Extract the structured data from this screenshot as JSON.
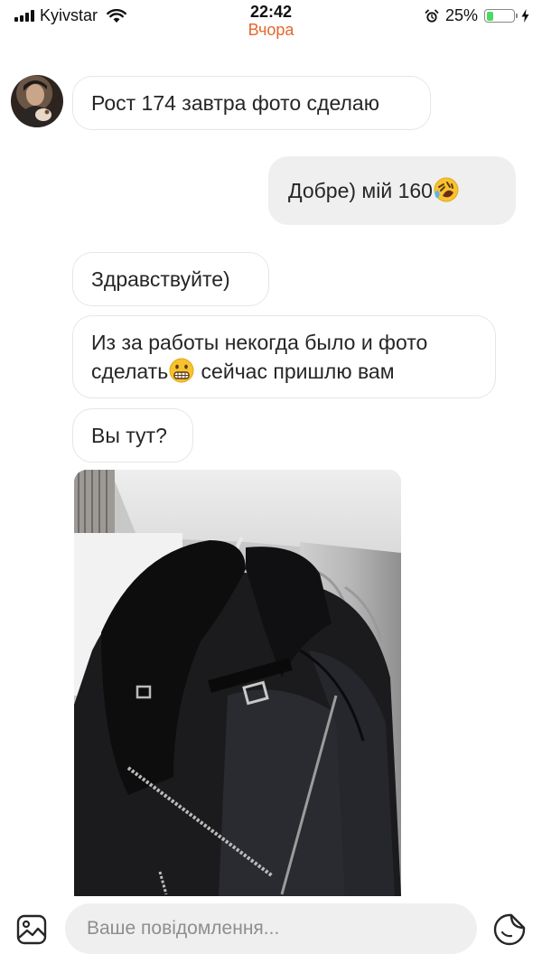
{
  "status_bar": {
    "carrier": "Kyivstar",
    "time": "22:42",
    "day_label": "Вчора",
    "battery_percent": "25%",
    "battery_level": 0.25,
    "icons": [
      "signal-icon",
      "wifi-icon",
      "alarm-icon",
      "battery-icon",
      "charging-bolt-icon"
    ]
  },
  "messages": [
    {
      "direction": "incoming",
      "text": "Рост 174 завтра фото сделаю"
    },
    {
      "direction": "outgoing",
      "text": "Добре) мій 160",
      "emoji": "rolling-laughing-emoji"
    },
    {
      "direction": "incoming",
      "text": "Здравствуйте)"
    },
    {
      "direction": "incoming",
      "line1": "Из за работы некогда было и фото",
      "line2_a": "сделать",
      "emoji": "grimacing-emoji",
      "line2_b": " сейчас пришлю вам"
    },
    {
      "direction": "incoming",
      "text": "Вы тут?"
    },
    {
      "direction": "incoming",
      "type": "photo",
      "subject": "black-leather-jacket-photo"
    }
  ],
  "composer": {
    "placeholder": "Ваше повідомлення...",
    "value": "",
    "icons": [
      "gallery-icon",
      "sticker-icon"
    ]
  },
  "colors": {
    "day_label": "#e4662d",
    "outgoing_bubble": "#efefef",
    "incoming_border": "#e6e6e6",
    "battery_fill": "#4cd964"
  }
}
